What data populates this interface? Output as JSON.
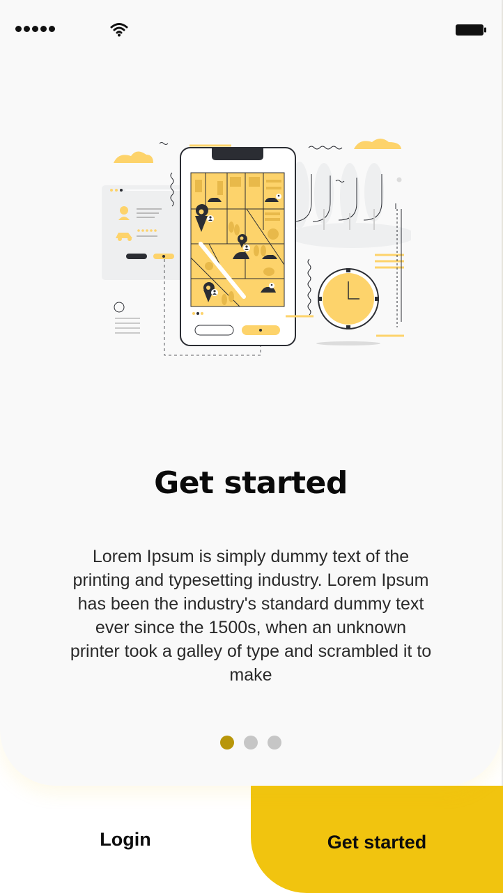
{
  "onboarding": {
    "title": "Get started",
    "description": "Lorem Ipsum is simply dummy text of the printing and typesetting industry. Lorem Ipsum has been the industry's standard dummy text ever since the 1500s, when an unknown printer took a galley of type and scrambled it to make",
    "pager": {
      "total": 3,
      "active_index": 0
    }
  },
  "actions": {
    "login_label": "Login",
    "get_started_label": "Get started"
  },
  "icons": {
    "signal": "signal-dots-icon",
    "wifi": "wifi-icon",
    "battery": "battery-icon",
    "illustration": "phone-map-illustration"
  },
  "colors": {
    "accent": "#f1c40f",
    "illustration_yellow": "#fdd36b",
    "pager_active": "#b8960a",
    "pager_inactive": "#c6c6c6",
    "card_background": "#f9f9f9",
    "text_dark": "#0a0a0a"
  }
}
